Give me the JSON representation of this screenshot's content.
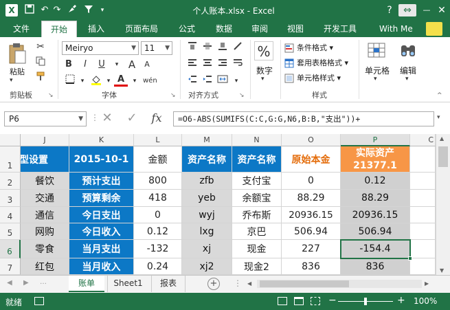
{
  "titlebar": {
    "logo": "X",
    "title": "个人账本.xlsx - Excel",
    "qat_icons": [
      "save-icon",
      "undo-icon",
      "redo-icon",
      "brush-icon",
      "filter-icon",
      "customize-qat-icon"
    ],
    "help": "?",
    "ribbon_display": "⇔",
    "minimize": "—",
    "restore": "□",
    "close": "✕"
  },
  "tabs": {
    "file": "文件",
    "home": "开始",
    "insert": "插入",
    "layout": "页面布局",
    "formulas": "公式",
    "data": "数据",
    "review": "审阅",
    "view": "视图",
    "dev": "开发工具",
    "user": "With Me"
  },
  "ribbon": {
    "clipboard": {
      "paste": "粘贴",
      "label": "剪贴板"
    },
    "font": {
      "name": "Meiryo",
      "size": "11",
      "bold": "B",
      "italic": "I",
      "underline": "U",
      "grow": "A",
      "shrink": "A",
      "wen": "wén",
      "color_a": "A",
      "label": "字体"
    },
    "align": {
      "label": "对齐方式"
    },
    "number": {
      "percent": "%",
      "label": "数字"
    },
    "styles": {
      "cond": "条件格式 ▾",
      "table": "套用表格格式 ▾",
      "cell": "单元格样式 ▾",
      "label": "样式"
    },
    "cells": {
      "label": "单元格"
    },
    "edit": {
      "label": "编辑"
    }
  },
  "formula": {
    "name_box": "P6",
    "cancel": "✕",
    "enter": "✓",
    "fx": "fx",
    "text": "=O6-ABS(SUMIFS(C:C,G:G,N6,B:B,\"支出\"))+"
  },
  "grid": {
    "columns": [
      "J",
      "K",
      "L",
      "M",
      "N",
      "O",
      "P",
      "C"
    ],
    "rows": [
      "1",
      "2",
      "3",
      "4",
      "5",
      "6",
      "7"
    ],
    "r1": {
      "J": "型设置",
      "K": "2015-10-1",
      "L": "金额",
      "M": "资产名称",
      "N": "资产名称",
      "O": "原始本金",
      "P_line1": "实际资产",
      "P_line2": "21377.1"
    },
    "r2": {
      "J": "餐饮",
      "K": "预计支出",
      "L": "800",
      "M": "zfb",
      "N": "支付宝",
      "O": "0",
      "P": "0.12"
    },
    "r3": {
      "J": "交通",
      "K": "预算剩余",
      "L": "418",
      "M": "yeb",
      "N": "余额宝",
      "O": "88.29",
      "P": "88.29"
    },
    "r4": {
      "J": "通信",
      "K": "今日支出",
      "L": "0",
      "M": "wyj",
      "N": "乔布斯",
      "O": "20936.15",
      "P": "20936.15"
    },
    "r5": {
      "J": "网购",
      "K": "今日收入",
      "L": "0.12",
      "M": "lxg",
      "N": "京巴",
      "O": "506.94",
      "P": "506.94"
    },
    "r6": {
      "J": "零食",
      "K": "当月支出",
      "L": "-132",
      "M": "xj",
      "N": "现金",
      "O": "227",
      "P": "-154.4"
    },
    "r7": {
      "J": "红包",
      "K": "当月收入",
      "L": "0.24",
      "M": "xj2",
      "N": "现金2",
      "O": "836",
      "P": "836"
    }
  },
  "sheets": {
    "prev": "◀",
    "next": "▶",
    "tab1": "账单",
    "tab2": "Sheet1",
    "tab3": "报表",
    "add": "+",
    "more": "⋮"
  },
  "status": {
    "ready": "就绪",
    "zoom": "100%",
    "zoom_minus": "−",
    "zoom_plus": "+"
  },
  "colors": {
    "excel_green": "#217346",
    "blue": "#0c78c6",
    "orange": "#f79646",
    "gray": "#d9d9d9"
  }
}
